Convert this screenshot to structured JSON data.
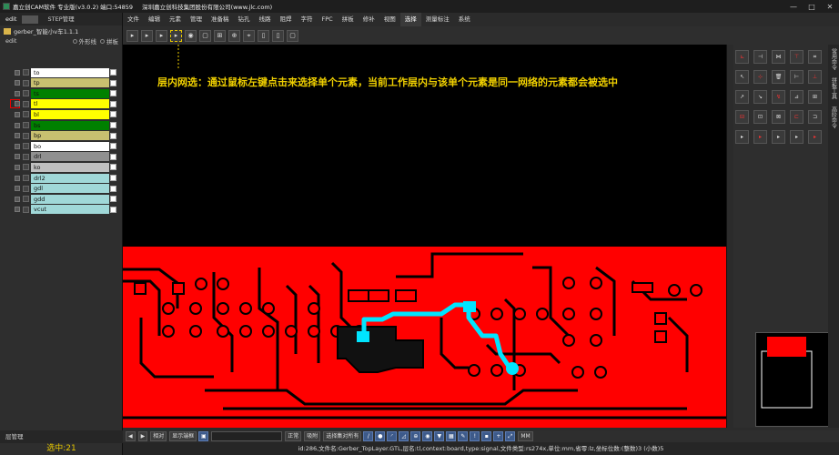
{
  "window": {
    "title": "嘉立创CAM软件 专业版(v3.0.2) 端口:54859",
    "company": "深圳嘉立创科技集团股份有限公司(www.jlc.com)",
    "controls": [
      "—",
      "□",
      "✕"
    ]
  },
  "left_panel": {
    "tabs": [
      "edit",
      "STEP管理"
    ],
    "project": "gerber_智能小v车1.1.1",
    "step": "edit",
    "radio_outline": "外形线",
    "radio_panel": "拼板",
    "layers": [
      {
        "name": "to",
        "color": "#ffffff"
      },
      {
        "name": "tp",
        "color": "#c8c070"
      },
      {
        "name": "ts",
        "color": "#008000"
      },
      {
        "name": "tl",
        "color": "#ffff00",
        "selected": true
      },
      {
        "name": "bl",
        "color": "#ffff00"
      },
      {
        "name": "bs",
        "color": "#008000"
      },
      {
        "name": "bp",
        "color": "#c8c070"
      },
      {
        "name": "bo",
        "color": "#ffffff"
      },
      {
        "name": "drl",
        "color": "#909090"
      },
      {
        "name": "ko",
        "color": "#c0c0c0"
      },
      {
        "name": "drl2",
        "color": "#a0d8d8"
      },
      {
        "name": "gdl",
        "color": "#a0d8d8"
      },
      {
        "name": "gdd",
        "color": "#a0d8d8"
      },
      {
        "name": "vcut",
        "color": "#a0d8d8"
      }
    ],
    "bottom_tab": "层管理",
    "selected_count": "选中:21"
  },
  "menu": {
    "items": [
      "文件",
      "编辑",
      "元素",
      "管理",
      "准备稿",
      "钻孔",
      "线路",
      "阻焊",
      "字符",
      "FPC",
      "拼板",
      "修补",
      "视图",
      "选择",
      "测量标注",
      "系统"
    ],
    "active": "选择"
  },
  "toolbar": {
    "buttons": [
      "select-arrow",
      "select-arrow-2",
      "select-arrow-3",
      "select-net-in-layer",
      "select-circle",
      "select-box",
      "select-grid",
      "select-connect",
      "select-poly",
      "select-step",
      "select-step-2",
      "select-clear"
    ]
  },
  "canvas": {
    "annotation": "层内网选：通过鼠标左键点击来选择单个元素，当前工作层内与该单个元素是同一网络的元素都会被选中",
    "board_color": "#ff0000",
    "highlight_color": "#00e5ff"
  },
  "right_panel": {
    "vertical_tabs": [
      "常用命令",
      "拼板工具",
      "高阶命令"
    ],
    "buttons": [
      "⊾",
      "⊣",
      "⋈",
      "⊤",
      "⌗",
      "↖",
      "⊹",
      "🗑",
      "⊢",
      "⊥",
      "↗",
      "↘",
      "↯",
      "⊿",
      "⊞",
      "⊟",
      "⊡",
      "⊠",
      "⊏",
      "⊐",
      "▸",
      "▸",
      "▸",
      "▸",
      "▸"
    ]
  },
  "bottom_bar": {
    "nav_prev": "◀",
    "nav_next": "▶",
    "mode": "相对",
    "show_label": "显示端框",
    "style": "正常",
    "snap": "吸附",
    "select_all": "选择集对所有",
    "unit": "MM"
  },
  "status": {
    "text": "id:286,文件名:Gerber_TopLayer.GTL,层名:tl,context:board,type:signal,文件类型:rs274x,单位:mm,省零:lz,坐标位数:(整数)3 (小数)5"
  }
}
